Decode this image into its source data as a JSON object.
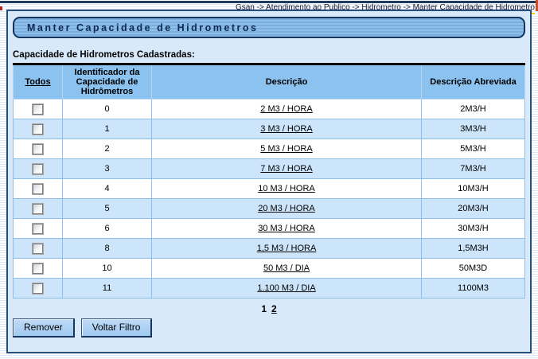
{
  "breadcrumb": "Gsan -> Atendimento ao Publico -> Hidrometro -> Manter Capacidade de Hidrometro",
  "page_title": "Manter Capacidade de Hidrometros",
  "section_label": "Capacidade de Hidrometros Cadastradas:",
  "table": {
    "headers": {
      "todos": "Todos",
      "id": "Identificador da Capacidade de Hidrômetros",
      "descricao": "Descrição",
      "abreviada": "Descrição Abreviada"
    },
    "rows": [
      {
        "id": "0",
        "descricao": "2 M3 / HORA",
        "abreviada": "2M3/H"
      },
      {
        "id": "1",
        "descricao": "3 M3 / HORA",
        "abreviada": "3M3/H"
      },
      {
        "id": "2",
        "descricao": "5 M3 / HORA",
        "abreviada": "5M3/H"
      },
      {
        "id": "3",
        "descricao": "7 M3 / HORA",
        "abreviada": "7M3/H"
      },
      {
        "id": "4",
        "descricao": "10 M3 / HORA",
        "abreviada": "10M3/H"
      },
      {
        "id": "5",
        "descricao": "20 M3 / HORA",
        "abreviada": "20M3/H"
      },
      {
        "id": "6",
        "descricao": "30 M3 / HORA",
        "abreviada": "30M3/H"
      },
      {
        "id": "8",
        "descricao": "1,5 M3 / HORA",
        "abreviada": "1,5M3H"
      },
      {
        "id": "10",
        "descricao": "50 M3 / DIA",
        "abreviada": "50M3D"
      },
      {
        "id": "11",
        "descricao": "1.100 M3 / DIA",
        "abreviada": "1100M3"
      }
    ]
  },
  "pagination": {
    "pages": [
      {
        "label": "1",
        "current": true
      },
      {
        "label": "2",
        "current": false
      }
    ]
  },
  "buttons": {
    "remover": "Remover",
    "voltar_filtro": "Voltar Filtro"
  },
  "colors": {
    "header_bg": "#8bc2f0",
    "row_alt_bg": "#cde5fa",
    "panel_bg": "#d7e9fb",
    "frame_navy": "#274d79",
    "breadcrumb_underline_gold": "#f2cf00",
    "button_bg": "#a5cdf3"
  }
}
